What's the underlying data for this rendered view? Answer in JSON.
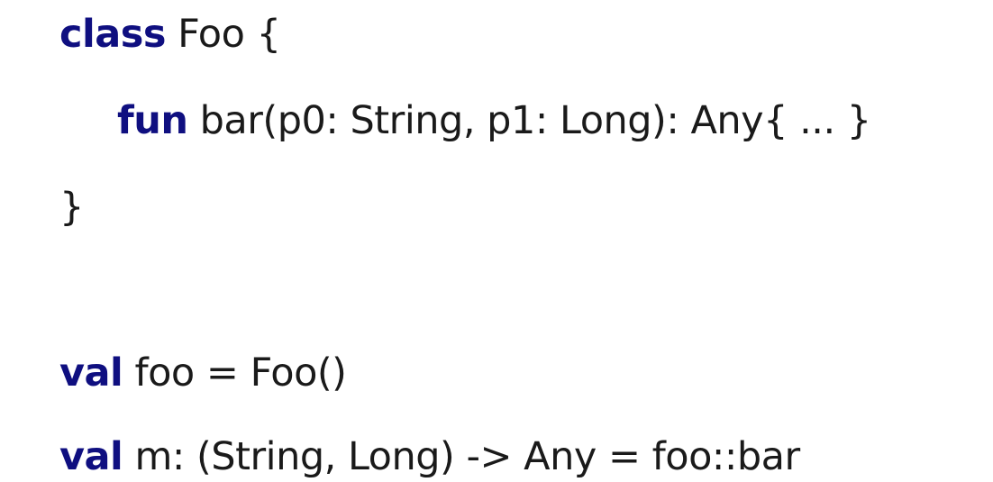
{
  "code": {
    "lines": [
      {
        "keyword": "class",
        "rest": " Foo {"
      },
      {
        "keyword": "fun",
        "rest": " bar(p0: String, p1: Long): Any{ ... }"
      },
      {
        "keyword": "",
        "rest": "}"
      },
      {
        "keyword": "val",
        "rest": " foo = Foo()"
      },
      {
        "keyword": "val",
        "rest": " m: (String, Long) -> Any = foo::bar"
      }
    ]
  },
  "colors": {
    "keyword": "#0f0f80",
    "text": "#1a1a1a",
    "background": "#ffffff"
  }
}
